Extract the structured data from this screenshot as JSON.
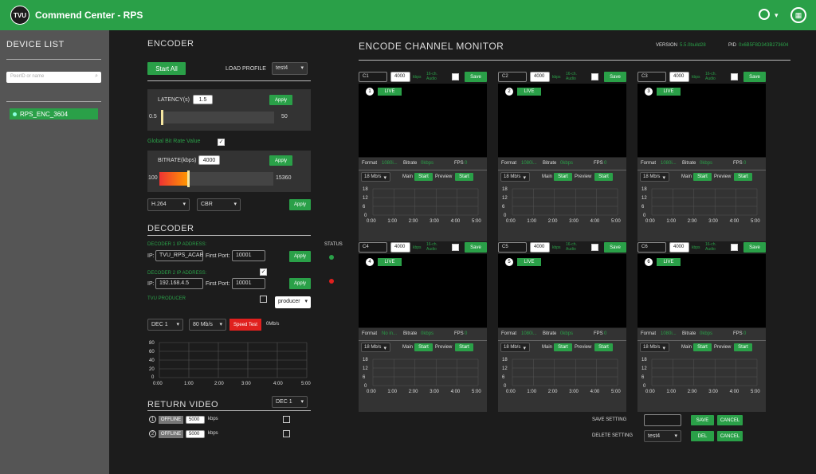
{
  "app": {
    "logo_text": "TVU",
    "title": "Commend Center - RPS"
  },
  "header_icons": {
    "user": "user-icon",
    "caret": "▾",
    "grid": "grid-icon",
    "grid_glyph": "▦"
  },
  "sidebar": {
    "title": "DEVICE LIST",
    "search_placeholder": "PeerID or name",
    "search_icon": "⌕",
    "device": "RPS_ENC_3604"
  },
  "encoder": {
    "title": "ENCODER",
    "start_all": "Start All",
    "load_profile_label": "LOAD PROFILE",
    "load_profile_value": "test4",
    "latency_label": "LATENCY(s)",
    "latency_value": "1.5",
    "latency_apply": "Apply",
    "latency_min": "0.5",
    "latency_max": "50",
    "latency_fraction": 0.01,
    "global_bitrate_label": "Global Bit Rate Value",
    "global_bitrate_checked": "✓",
    "bitrate_label": "BITRATE(kbps)",
    "bitrate_value": "4000",
    "bitrate_apply": "Apply",
    "bitrate_min": "100",
    "bitrate_max": "15360",
    "bitrate_fraction": 0.255,
    "codec": "H.264",
    "mode": "CBR",
    "apply": "Apply"
  },
  "decoder": {
    "title": "DECODER",
    "status_label": "STATUS",
    "dec1_label": "DECODER 1 IP ADDRESS:",
    "ip_label": "IP:",
    "dec1_ip": "TVU_RPS_ACAB",
    "first_port_label": "First Port:",
    "dec1_port": "10001",
    "dec1_apply": "Apply",
    "dec2_label": "DECODER 2 IP ADDRESS:",
    "dec2_checked": "✓",
    "dec2_ip": "192.168.4.5",
    "dec2_port": "10001",
    "dec2_apply": "Apply",
    "tvu_producer_label": "TVU PRODUCER",
    "producer_select": "producer",
    "dec_select": "DEC 1",
    "rate_select": "80 Mb/s",
    "speed_test": "Speed Test",
    "speed_value": "0Mb/s",
    "status_colors": {
      "dec1": "#2aa048",
      "dec2": "#e0201e"
    }
  },
  "decoder_chart": {
    "y_ticks": [
      "80",
      "60",
      "40",
      "20",
      "0"
    ],
    "x_ticks": [
      "0:00",
      "1:00",
      "2:00",
      "3:00",
      "4:00",
      "5:00"
    ]
  },
  "return_video": {
    "title": "RETURN VIDEO",
    "dec_select": "DEC 1",
    "rows": [
      {
        "num": "1",
        "status": "OFFLINE",
        "value": "5000",
        "unit": "kbps"
      },
      {
        "num": "2",
        "status": "OFFLINE",
        "value": "5000",
        "unit": "kbps"
      }
    ]
  },
  "monitor": {
    "title": "ENCODE CHANNEL MONITOR",
    "version_label": "VERSION",
    "version_value": "5.5.0build28",
    "pid_label": "PID",
    "pid_value": "0x6B5F8D343B273604",
    "bitrate_unit": "kbps",
    "audio_label": "16-ch. Audio",
    "save": "Save",
    "live": "LIVE",
    "format_label": "Format",
    "bitrate_label": "Bitrate",
    "fps_label": "FPS",
    "rate_select": "18 Mb/s",
    "main_label": "Main",
    "preview_label": "Preview",
    "start": "Start",
    "y_ticks": [
      "18",
      "12",
      "6",
      "0"
    ],
    "x_ticks": [
      "0:00",
      "1:00",
      "2:00",
      "3:00",
      "4:00",
      "5:00"
    ],
    "channels": [
      {
        "id": "C1",
        "num": "1",
        "bitrate_in": "4000",
        "format": "1080i...",
        "bitrate": "0kbps",
        "fps": "0"
      },
      {
        "id": "C2",
        "num": "2",
        "bitrate_in": "4000",
        "format": "1080i...",
        "bitrate": "0kbps",
        "fps": "0"
      },
      {
        "id": "C3",
        "num": "3",
        "bitrate_in": "4000",
        "format": "1080i...",
        "bitrate": "0kbps",
        "fps": "0"
      },
      {
        "id": "C4",
        "num": "4",
        "bitrate_in": "4000",
        "format": "No in...",
        "bitrate": "0kbps",
        "fps": "0"
      },
      {
        "id": "C5",
        "num": "5",
        "bitrate_in": "4000",
        "format": "1080i...",
        "bitrate": "0kbps",
        "fps": "0"
      },
      {
        "id": "C6",
        "num": "6",
        "bitrate_in": "4000",
        "format": "1080i...",
        "bitrate": "0kbps",
        "fps": "0"
      }
    ]
  },
  "settings": {
    "save_label": "SAVE SETTING",
    "save": "SAVE",
    "cancel": "CANCEL",
    "delete_label": "DELETE SETTING",
    "delete_select": "test4",
    "del": "DEL",
    "cancel2": "CANCEL"
  }
}
